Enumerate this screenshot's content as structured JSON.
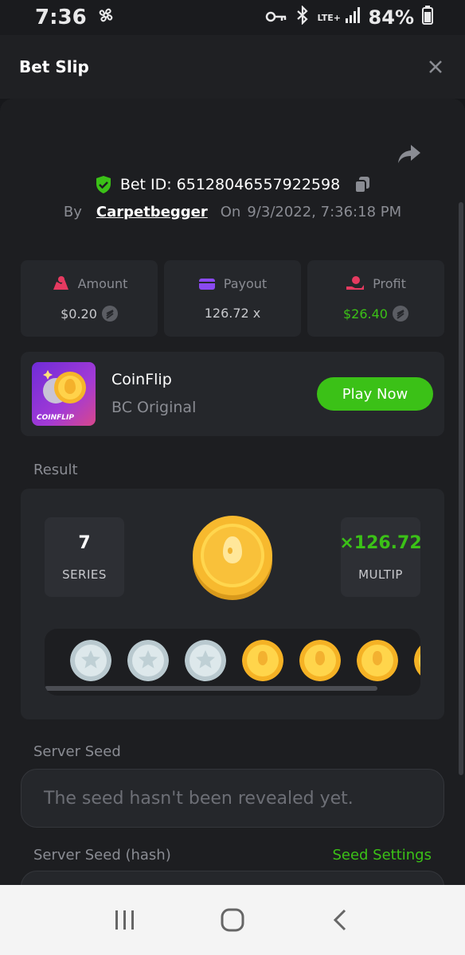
{
  "status_bar": {
    "time": "7:36",
    "network": "LTE+",
    "battery": "84%"
  },
  "header": {
    "title": "Bet Slip"
  },
  "bet": {
    "id_label": "Bet ID:",
    "id": "65128046557922598",
    "by_label": "By",
    "user": "Carpetbegger",
    "on_label": "On",
    "datetime": "9/3/2022, 7:36:18 PM"
  },
  "stats": [
    {
      "label": "Amount",
      "value": "$0.20"
    },
    {
      "label": "Payout",
      "value": "126.72 x"
    },
    {
      "label": "Profit",
      "value": "$26.40"
    }
  ],
  "game": {
    "name": "CoinFlip",
    "subtitle": "BC Original",
    "thumb_text": "COINFLIP",
    "play_label": "Play Now"
  },
  "result": {
    "section_label": "Result",
    "series_value": "7",
    "series_label": "SERIES",
    "multip_value": "×126.72",
    "multip_label": "MULTIP",
    "coins": [
      "silver",
      "silver",
      "silver",
      "gold",
      "gold",
      "gold",
      "gold"
    ]
  },
  "server_seed": {
    "label": "Server Seed",
    "value": "The seed hasn't been revealed yet."
  },
  "server_seed_hash": {
    "label": "Server Seed (hash)",
    "settings_label": "Seed Settings"
  },
  "colors": {
    "accent_green": "#3bc117",
    "background": "#1d1e21",
    "card": "#25272b"
  }
}
